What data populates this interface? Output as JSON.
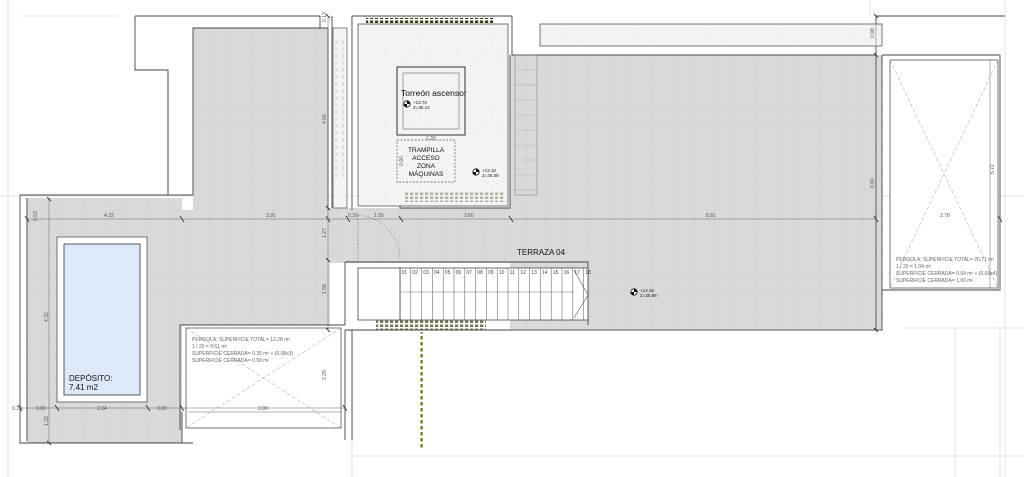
{
  "labels": {
    "torreon": "Torreón ascensor",
    "trampilla": [
      "TRAMPILLA",
      "ACCESO",
      "ZONA",
      "MÁQUINAS"
    ],
    "terraza": "TERRAZA 04",
    "deposito": [
      "DEPÓSITO:",
      "7.41 m2"
    ]
  },
  "levels": [
    {
      "top": "+13.73",
      "bottom": "Z=36.10"
    },
    {
      "top": "+13.18",
      "bottom": "Z=35.58"
    },
    {
      "top": "+13.18",
      "bottom": "Z=35.58"
    }
  ],
  "pergola_left": [
    "PERGOLA: SUPERFICIE TOTAL= 12.28 m²",
    "1 / 20 = 0.61 m²",
    "SUPERFICIE CERRADA= 0.35 m² + (0.08x3)",
    "SUPERFICIE CERRADA= 0.59 m²"
  ],
  "pergola_right": [
    "PERGOLA: SUPERFICIE TOTAL= 20.71 m²",
    "1 / 20 = 1.04 m²",
    "SUPERFICIE CERRADA= 0.64 m² + (0.09x4)",
    "SUPERFICIE CERRADA= 1.00 m²"
  ],
  "dims": {
    "d_4_32": "4.32",
    "d_3_91": "3.91",
    "d_0_30": "0.30",
    "d_1_05": "1.05",
    "d_3_60": "3.60",
    "d_8_81": "8.81",
    "d_2_78": "2.78",
    "d_0_53": "0.53",
    "d_4_32v": "4.32",
    "d_0_13": "0.13",
    "d_0_80a": "0.80",
    "d_2_34": "2.34",
    "d_0_80b": "0.80",
    "d_3_90": "3.90",
    "d_2_29": "2.29",
    "d_1_20": "1.20",
    "d_0_90": "0.90",
    "d_4_66": "4.66",
    "d_1_27": "1.27",
    "d_1_58": "1.58",
    "d_0_13b": "0.13",
    "d_0_98": "0.98",
    "d_6_80": "6.80",
    "d_5_72": "5.72",
    "d_1_33": "1.33"
  },
  "steps": [
    "01",
    "02",
    "03",
    "04",
    "05",
    "06",
    "07",
    "08",
    "09",
    "10",
    "11",
    "12",
    "13",
    "14",
    "15",
    "16",
    "17",
    "18"
  ],
  "colors": {
    "floor": "#d9d9d9",
    "pool": "#dde9f8",
    "wall": "#444444",
    "grid": "#c4c4c4",
    "dots": "#7a6a10"
  }
}
